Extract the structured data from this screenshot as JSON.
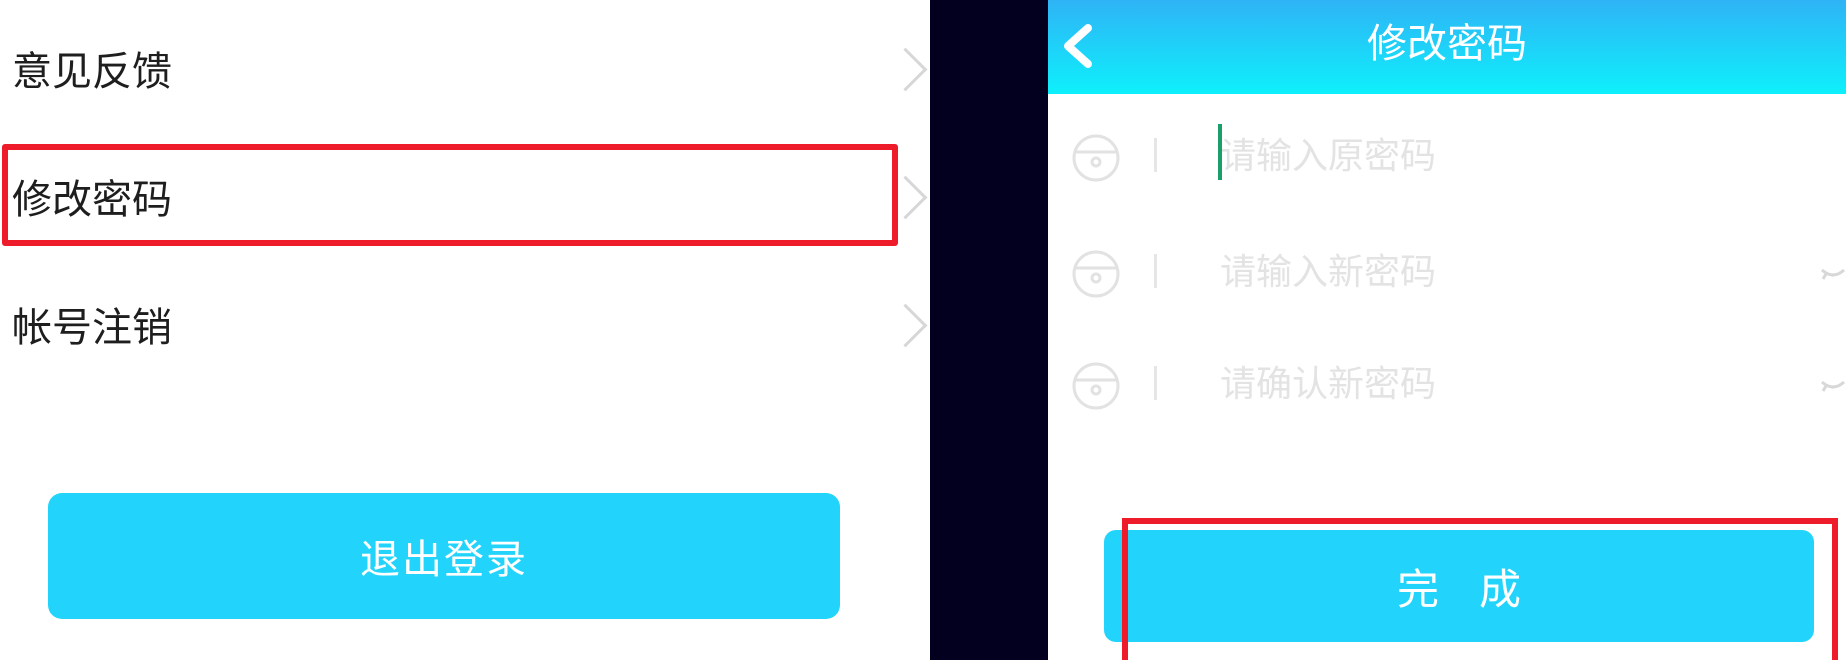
{
  "left": {
    "menu": [
      {
        "label": "意见反馈",
        "icon": "chevron-right-icon"
      },
      {
        "label": "修改密码",
        "icon": "chevron-right-icon",
        "highlighted": true
      },
      {
        "label": "帐号注销",
        "icon": "chevron-right-icon"
      }
    ],
    "logout_label": "退出登录",
    "button_color": "#22d4fb"
  },
  "right": {
    "title": "修改密码",
    "back_icon": "chevron-left-icon",
    "fields": {
      "old_password": {
        "placeholder": "请输入原密码",
        "icon": "lock-icon"
      },
      "new_password": {
        "placeholder": "请输入新密码",
        "icon": "lock-icon",
        "toggle_icon": "eye-closed-icon"
      },
      "confirm_password": {
        "placeholder": "请确认新密码",
        "icon": "lock-icon",
        "toggle_icon": "eye-closed-icon"
      }
    },
    "done_label": "完成",
    "header_gradient": [
      "#2fb3f6",
      "#0ef0fb"
    ]
  },
  "highlight_color": "#ee1c2a"
}
